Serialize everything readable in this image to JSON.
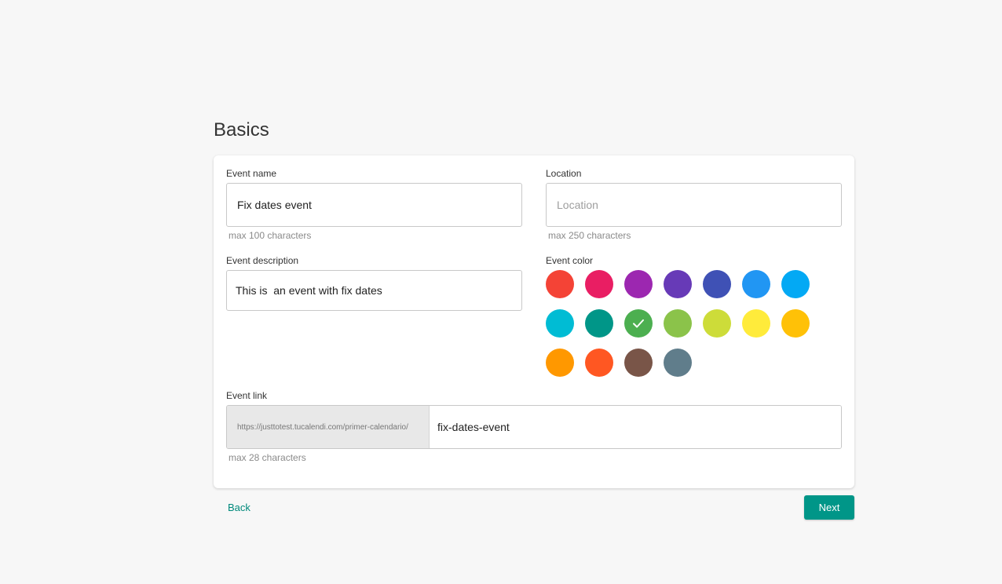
{
  "page": {
    "title": "Basics"
  },
  "form": {
    "event_name": {
      "label": "Event name",
      "value": "Fix dates event",
      "hint": "max 100 characters"
    },
    "location": {
      "label": "Location",
      "value": "",
      "placeholder": "Location",
      "hint": "max 250 characters"
    },
    "event_description": {
      "label": "Event description",
      "value": "This is  an event with fix dates"
    },
    "event_color": {
      "label": "Event color",
      "selected": "#4caf50",
      "options": [
        "#f44336",
        "#e91e63",
        "#9c27b0",
        "#673ab7",
        "#3f51b5",
        "#2196f3",
        "#03a9f4",
        "#00bcd4",
        "#009688",
        "#4caf50",
        "#8bc34a",
        "#cddc39",
        "#ffeb3b",
        "#ffc107",
        "#ff9800",
        "#ff5722",
        "#795548",
        "#607d8b"
      ]
    },
    "event_link": {
      "label": "Event link",
      "prefix": "https://justtotest.tucalendi.com/primer-calendario/",
      "value": "fix-dates-event",
      "hint": "max 28 characters"
    }
  },
  "actions": {
    "back_label": "Back",
    "next_label": "Next"
  },
  "theme": {
    "accent": "#009688",
    "check_icon": "check-icon"
  }
}
